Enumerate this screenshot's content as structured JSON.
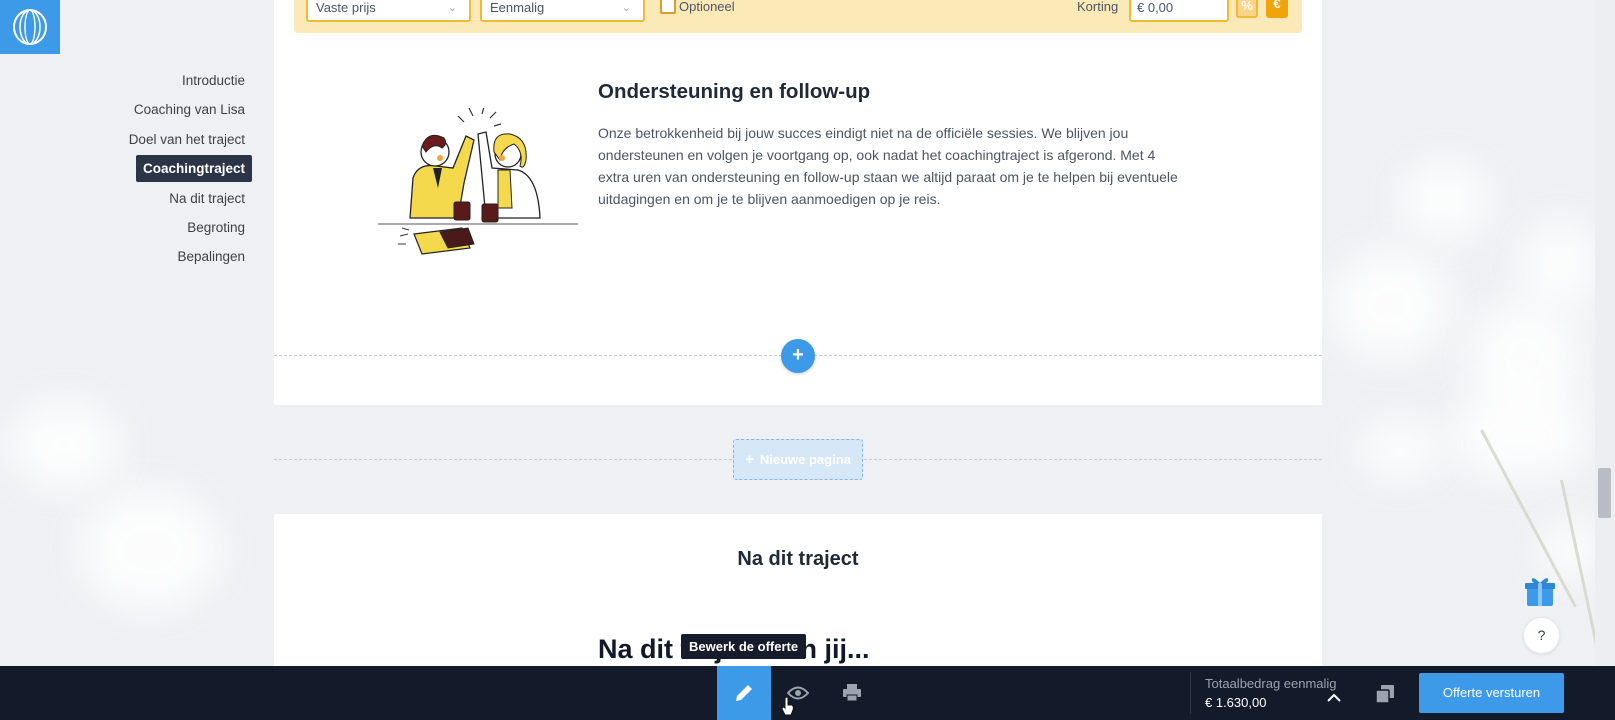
{
  "nav": {
    "items": [
      {
        "label": "Introductie"
      },
      {
        "label": "Coaching van Lisa"
      },
      {
        "label": "Doel van het traject"
      },
      {
        "label": "Coachingtraject"
      },
      {
        "label": "Na dit traject"
      },
      {
        "label": "Begroting"
      },
      {
        "label": "Bepalingen"
      }
    ],
    "active": "Coachingtraject"
  },
  "price_bar": {
    "price_type": "Vaste prijs",
    "frequency": "Eenmalig",
    "optional_label": "Optioneel",
    "optional_checked": false,
    "discount_label": "Korting",
    "discount_value": "€ 0,00",
    "percent_symbol": "%",
    "euro_symbol": "€"
  },
  "section": {
    "title": "Ondersteuning en follow-up",
    "body": "Onze betrokkenheid bij jouw succes eindigt niet na de officiële sessies. We blijven jou ondersteunen en volgen je voortgang op, ook nadat het coachingtraject is afgerond. Met 4 extra uren van ondersteuning en follow-up staan we altijd paraat om je te helpen bij eventuele uitdagingen en om je te blijven aanmoedigen op je reis."
  },
  "add_symbol": "+",
  "new_page": {
    "label": "Nieuwe pagina",
    "plus": "+"
  },
  "next_page": {
    "title": "Na dit traject",
    "heading": "Na dit traject kun jij..."
  },
  "tooltip": "Bewerk de offerte",
  "help_label": "?",
  "toolbar": {
    "total_label": "Totaalbedrag eenmalig",
    "total_value": "€ 1.630,00",
    "send_label": "Offerte versturen"
  },
  "colors": {
    "accent": "#3c9ae8",
    "dark": "#131a2a",
    "highlight": "#fce9b8",
    "orange": "#f0a30a"
  },
  "icons": {
    "logo": "logo-icon",
    "edit": "pencil-icon",
    "view": "eye-icon",
    "print": "printer-icon",
    "expand": "chevron-up-icon",
    "copy": "copy-icon",
    "gift": "gift-icon",
    "cursor": "cursor-icon"
  }
}
